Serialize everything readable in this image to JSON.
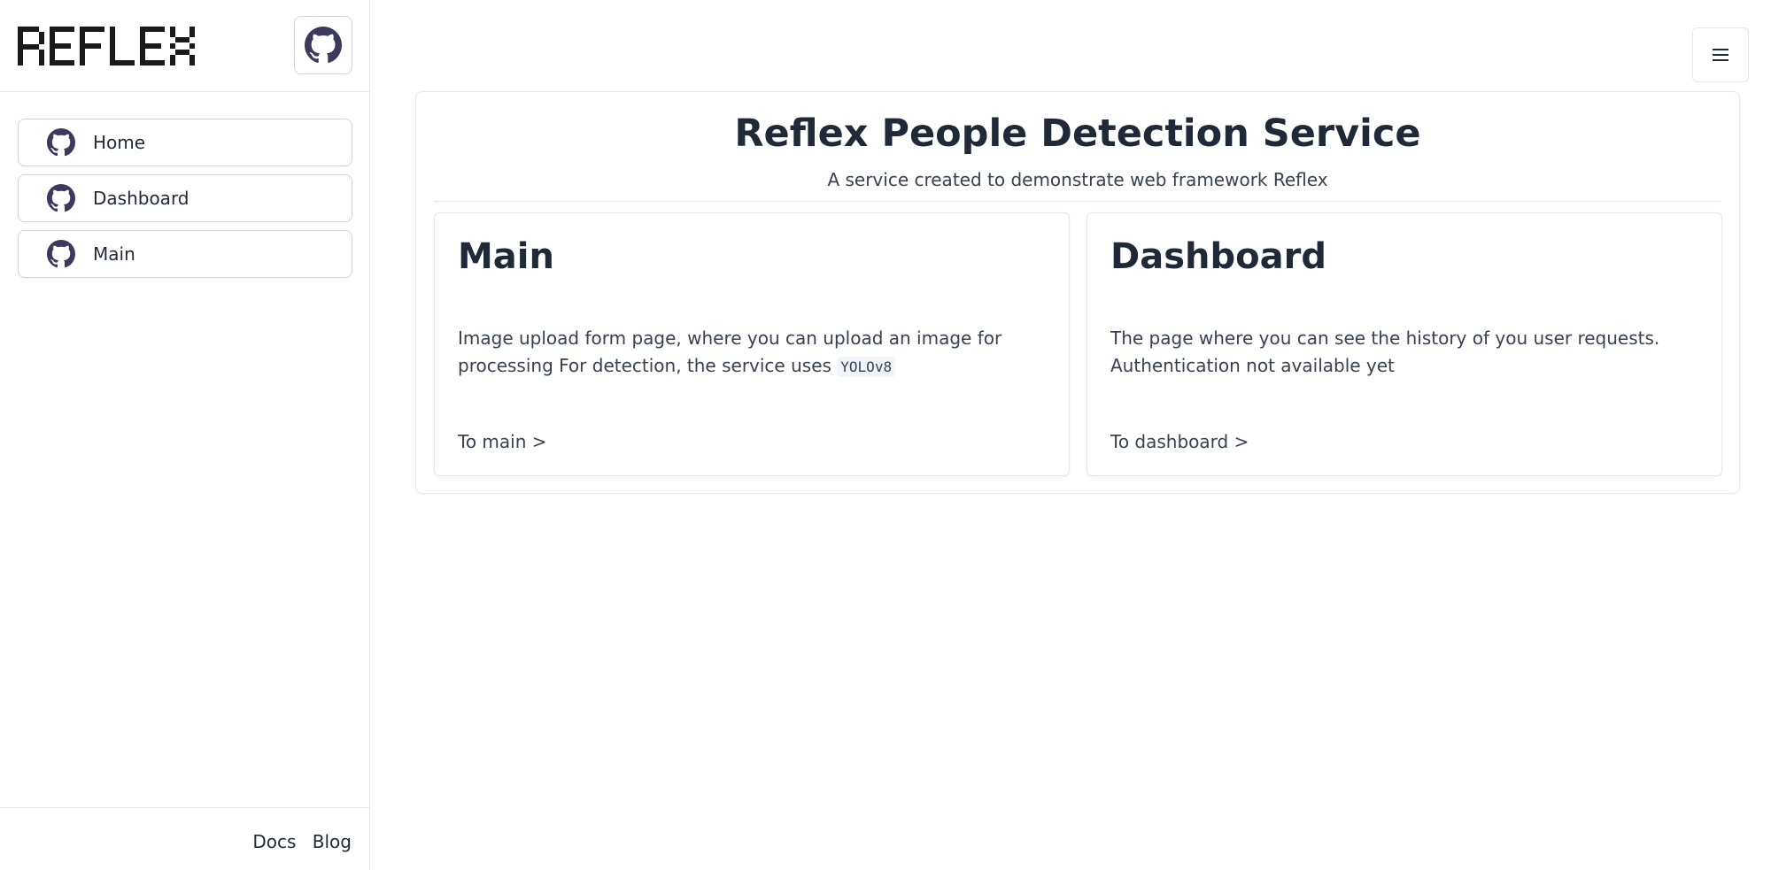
{
  "app": {
    "logo_text": "REFLEX",
    "icons": {
      "logo": "reflex-logo",
      "github": "github-icon",
      "menu": "hamburger-menu-icon"
    },
    "colors": {
      "icon": "#3b3a5c",
      "text": "#1f2937",
      "border": "#e5e7eb"
    }
  },
  "sidebar": {
    "items": [
      {
        "label": "Home",
        "icon": "github-icon"
      },
      {
        "label": "Dashboard",
        "icon": "github-icon"
      },
      {
        "label": "Main",
        "icon": "github-icon"
      }
    ],
    "footer": {
      "docs_label": "Docs",
      "blog_label": "Blog"
    }
  },
  "main": {
    "title": "Reflex People Detection Service",
    "subtitle": "A service created to demonstrate web framework Reflex",
    "cards": [
      {
        "title": "Main",
        "description": "Image upload form page, where you can upload an image for processing For detection, the service uses",
        "code": "YOLOv8",
        "link": "To main >"
      },
      {
        "title": "Dashboard",
        "description": "The page where you can see the history of you user requests. Authentication not available yet",
        "code": "",
        "link": "To dashboard >"
      }
    ]
  }
}
